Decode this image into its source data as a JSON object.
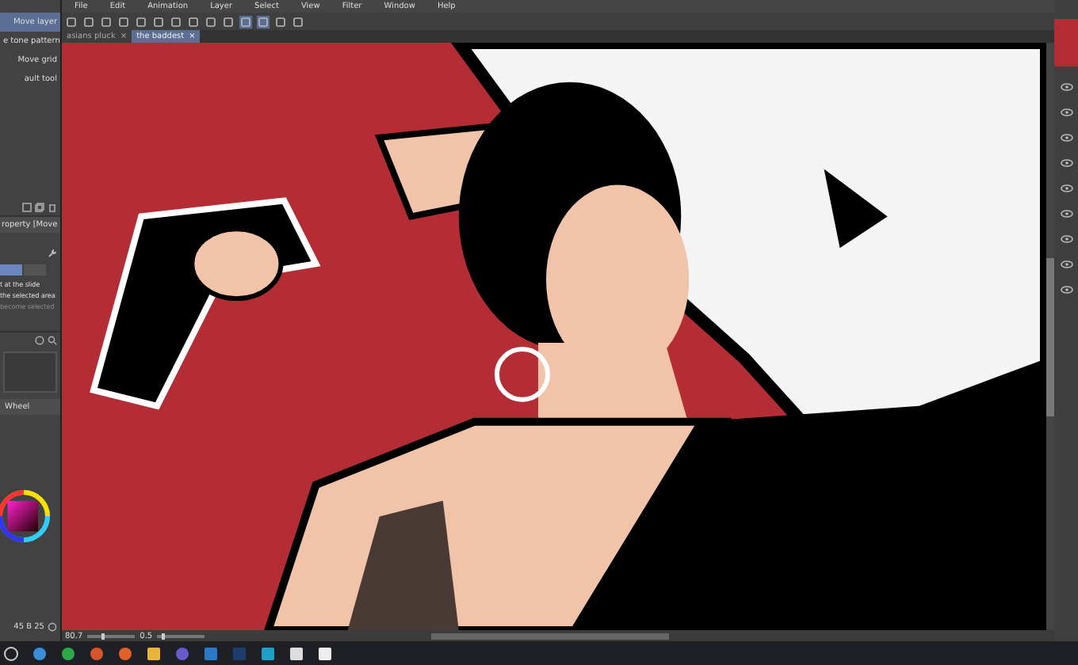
{
  "menu": [
    "File",
    "Edit",
    "Animation",
    "Layer",
    "Select",
    "View",
    "Filter",
    "Window",
    "Help"
  ],
  "tabs": [
    {
      "label": "asians pluck",
      "close": "×",
      "selected": false
    },
    {
      "label": "the baddest",
      "close": "×",
      "selected": true
    }
  ],
  "subtools": [
    {
      "label": "Move layer",
      "selected": true
    },
    {
      "label": "e tone pattern",
      "selected": false
    },
    {
      "label": "Move grid",
      "selected": false
    },
    {
      "label": "ault tool",
      "selected": false
    }
  ],
  "tool_property": {
    "title": "roperty [Move",
    "options": [
      {
        "label": "t at the slide",
        "disabled": false
      },
      {
        "label": "the selected area",
        "disabled": false
      },
      {
        "label": "become selected",
        "disabled": true
      }
    ]
  },
  "color_panel": {
    "tab": "Wheel",
    "readout": "45 B 25"
  },
  "status_bar": {
    "zoom": "80.7",
    "zoom_slider": {
      "level": 0.3
    },
    "angle": "0.5",
    "angle_slider": {
      "level": 0.1
    }
  }
}
